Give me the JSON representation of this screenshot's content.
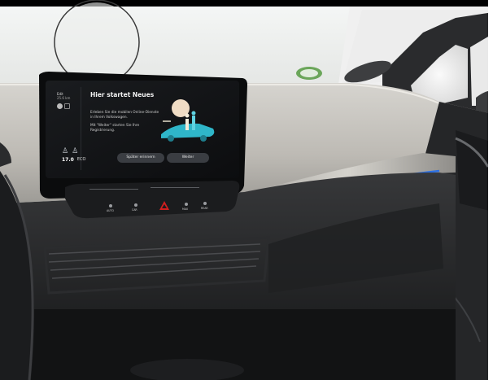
{
  "photo": {
    "subject": "",
    "colors": {
      "dashboard_light": "#c9c7c1",
      "dashboard_dark": "#2b2c2e",
      "screen_bg": "#111316",
      "ambient_blue": "#2d6fe0",
      "windshield": "#f1f3f2"
    }
  },
  "screen": {
    "status_line1": "Edit",
    "status_line2": "25.6 km",
    "title": "Hier startet Neues",
    "body1": "Erleben Sie die mobilen Online-Dienste in Ihrem Volkswagen.",
    "body2": "Mit \"Weiter\" starten Sie Ihre Registrierung.",
    "button_later": "Später erinnern",
    "button_next": "Weiter",
    "temp_left": "17.0",
    "temp_right": "ECO",
    "seat_icons": [
      "seat-icon",
      "seat-icon"
    ]
  },
  "controls": {
    "labels": [
      "AUTO",
      "CAR",
      "",
      "MAX",
      "REAR"
    ]
  }
}
